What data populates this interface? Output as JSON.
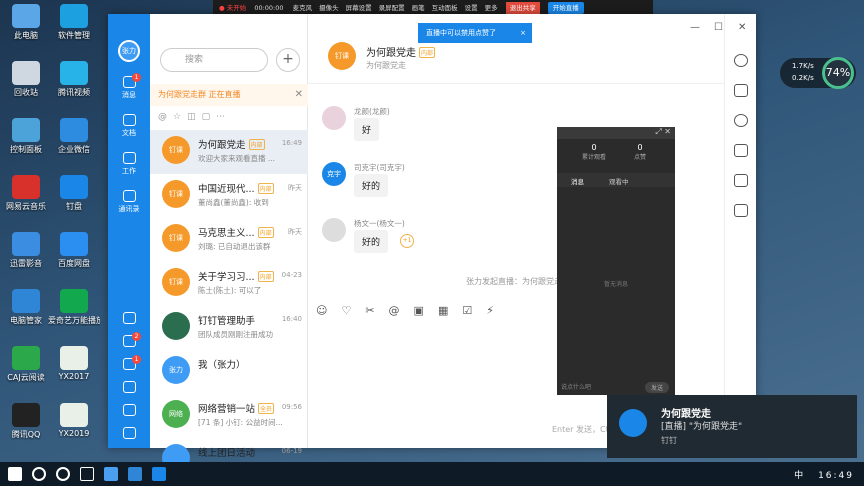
{
  "desktop": {
    "icons": [
      {
        "label": "此电脑",
        "color": "#5aa6e6"
      },
      {
        "label": "回收站",
        "color": "#cfd8e0"
      },
      {
        "label": "控制面板",
        "color": "#4ba3d9"
      },
      {
        "label": "网易云音乐",
        "color": "#d8302b"
      },
      {
        "label": "迅雷影音",
        "color": "#3a8de0"
      },
      {
        "label": "电脑管家",
        "color": "#2f86d6"
      },
      {
        "label": "CAJ云阅读",
        "color": "#2aa84a"
      },
      {
        "label": "腾讯QQ",
        "color": "#222222"
      },
      {
        "label": "软件管理",
        "color": "#1da0e0"
      },
      {
        "label": "腾讯视频",
        "color": "#27b3e8"
      },
      {
        "label": "企业微信",
        "color": "#2d8ce0"
      },
      {
        "label": "钉盘",
        "color": "#1a87e8"
      },
      {
        "label": "百度网盘",
        "color": "#2a8ff0"
      },
      {
        "label": "爱奇艺万能播放器 HD1280高清",
        "color": "#11a84e"
      },
      {
        "label": "YX2017",
        "color": "#e8f0e8"
      },
      {
        "label": "YX2019",
        "color": "#e8f0e8"
      }
    ]
  },
  "app": {
    "user_avatar": "张力",
    "rail": [
      {
        "label": "消息",
        "badge": "1"
      },
      {
        "label": "文档",
        "badge": ""
      },
      {
        "label": "工作",
        "badge": ""
      },
      {
        "label": "通讯录",
        "badge": ""
      }
    ],
    "rail_bottom_badges": [
      "",
      "2",
      "1",
      "",
      "",
      ""
    ],
    "search_placeholder": "搜索",
    "live_banner": "为何跟党走群 正在直播",
    "conversations": [
      {
        "name": "为何跟党走",
        "tag": "内部",
        "time": "16:49",
        "preview": "欢迎大家来观看直播 ...",
        "avatar": "钉课",
        "color": "#f59a2a"
      },
      {
        "name": "中国近现代...",
        "tag": "内部",
        "time": "昨天",
        "preview": "董尚鑫(董尚鑫): 收到",
        "avatar": "钉课",
        "color": "#f59a2a"
      },
      {
        "name": "马克思主义...",
        "tag": "内部",
        "time": "昨天",
        "preview": "刘璐: 已自动退出该群",
        "avatar": "钉课",
        "color": "#f59a2a"
      },
      {
        "name": "关于学习习...",
        "tag": "内部",
        "time": "04-23",
        "preview": "陈土(陈土): 可以了",
        "avatar": "钉课",
        "color": "#f59a2a"
      },
      {
        "name": "钉钉管理助手",
        "tag": "",
        "time": "16:40",
        "preview": "团队成员刚刚注册成功",
        "avatar": "",
        "color": "#2b6e4f"
      },
      {
        "name": "我（张力）",
        "tag": "",
        "time": "",
        "preview": "",
        "avatar": "张力",
        "color": "#3f9cf5"
      },
      {
        "name": "网络营销一站",
        "tag": "全员",
        "time": "09:56",
        "preview": "[71 条] 小钉: 公益时间...",
        "avatar": "网络",
        "color": "#4caf50"
      },
      {
        "name": "线上团日活动",
        "tag": "",
        "time": "06-19",
        "preview": "",
        "avatar": "",
        "color": "#3f9cf5"
      }
    ],
    "chat": {
      "title": "为何跟党走",
      "title_tag": "内部",
      "subtitle": "为何跟党走",
      "avatar": "钉课",
      "messages": [
        {
          "sender": "龙颜(龙颜)",
          "text": "好",
          "avatar": "",
          "color": "#e9d2dc"
        },
        {
          "sender": "司克宇(司克宇)",
          "text": "好的",
          "avatar": "克宇",
          "color": "#1a87e8"
        },
        {
          "sender": "杨文一(杨文一)",
          "text": "好的",
          "avatar": "",
          "color": "#dddddd",
          "reaction": "+1"
        }
      ],
      "system_msg": "张力发起直播：为何跟党走",
      "input_hint": "Enter 发送，Ctrl+Enter 换行"
    },
    "window_controls": [
      "—",
      "☐",
      "✕"
    ]
  },
  "live_panel": {
    "stats": [
      {
        "value": "0",
        "label": "累计观看"
      },
      {
        "value": "0",
        "label": "点赞"
      }
    ],
    "tabs": [
      "消息",
      "观看中"
    ],
    "empty": "暂无消息",
    "input": "说点什么吧",
    "send": "发送"
  },
  "topbar": {
    "recording": "● 未开始",
    "timer": "00:00:00",
    "items": [
      "麦克风",
      "摄像头",
      "屏幕设置",
      "录屏配置",
      "画笔",
      "互动面板",
      "设置",
      "更多"
    ],
    "stop": "退出共享",
    "start": "开始直播"
  },
  "tip": {
    "text": "直播中可以禁用点赞了",
    "close": "×"
  },
  "notification": {
    "title": "为何跟党走",
    "message": "[直播] \"为何跟党走\"",
    "app": "钉钉"
  },
  "net_meter": {
    "up": "1.7K/s",
    "down": "0.2K/s",
    "percent": "74%"
  },
  "taskbar": {
    "time": "16:49",
    "ime": "中"
  }
}
